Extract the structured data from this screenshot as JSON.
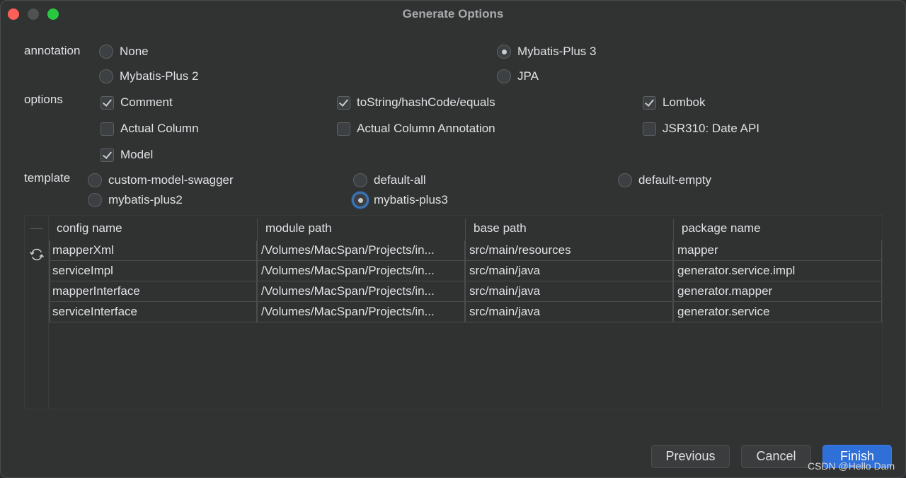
{
  "window": {
    "title": "Generate Options"
  },
  "annotation": {
    "label": "annotation",
    "selected": "Mybatis-Plus 3",
    "options": [
      {
        "label": "None",
        "selected": false
      },
      {
        "label": "Mybatis-Plus 3",
        "selected": true
      },
      {
        "label": "Mybatis-Plus 2",
        "selected": false
      },
      {
        "label": "JPA",
        "selected": false
      }
    ]
  },
  "options": {
    "label": "options",
    "items": [
      {
        "label": "Comment",
        "checked": true
      },
      {
        "label": "toString/hashCode/equals",
        "checked": true
      },
      {
        "label": "Lombok",
        "checked": true
      },
      {
        "label": "Actual Column",
        "checked": false
      },
      {
        "label": "Actual Column Annotation",
        "checked": false
      },
      {
        "label": "JSR310: Date API",
        "checked": false
      },
      {
        "label": "Model",
        "checked": true
      }
    ]
  },
  "template": {
    "label": "template",
    "selected": "mybatis-plus3",
    "options": [
      {
        "label": "custom-model-swagger",
        "selected": false
      },
      {
        "label": "default-all",
        "selected": false
      },
      {
        "label": "default-empty",
        "selected": false
      },
      {
        "label": "mybatis-plus2",
        "selected": false
      },
      {
        "label": "mybatis-plus3",
        "selected": true
      }
    ]
  },
  "table": {
    "gutter_icons": [
      "minus-icon",
      "refresh-icon"
    ],
    "columns": [
      "config name",
      "module path",
      "base path",
      "package name"
    ],
    "rows": [
      [
        "mapperXml",
        "/Volumes/MacSpan/Projects/in...",
        "src/main/resources",
        "mapper"
      ],
      [
        "serviceImpl",
        "/Volumes/MacSpan/Projects/in...",
        "src/main/java",
        "generator.service.impl"
      ],
      [
        "mapperInterface",
        "/Volumes/MacSpan/Projects/in...",
        "src/main/java",
        "generator.mapper"
      ],
      [
        "serviceInterface",
        "/Volumes/MacSpan/Projects/in...",
        "src/main/java",
        "generator.service"
      ]
    ]
  },
  "buttons": {
    "previous": "Previous",
    "cancel": "Cancel",
    "finish": "Finish"
  },
  "watermark": "CSDN @Hello Dam",
  "colors": {
    "primary_button": "#2f6fd8",
    "focus_ring": "#3b75b5",
    "close": "#fe5f57",
    "maximize": "#28c840"
  }
}
